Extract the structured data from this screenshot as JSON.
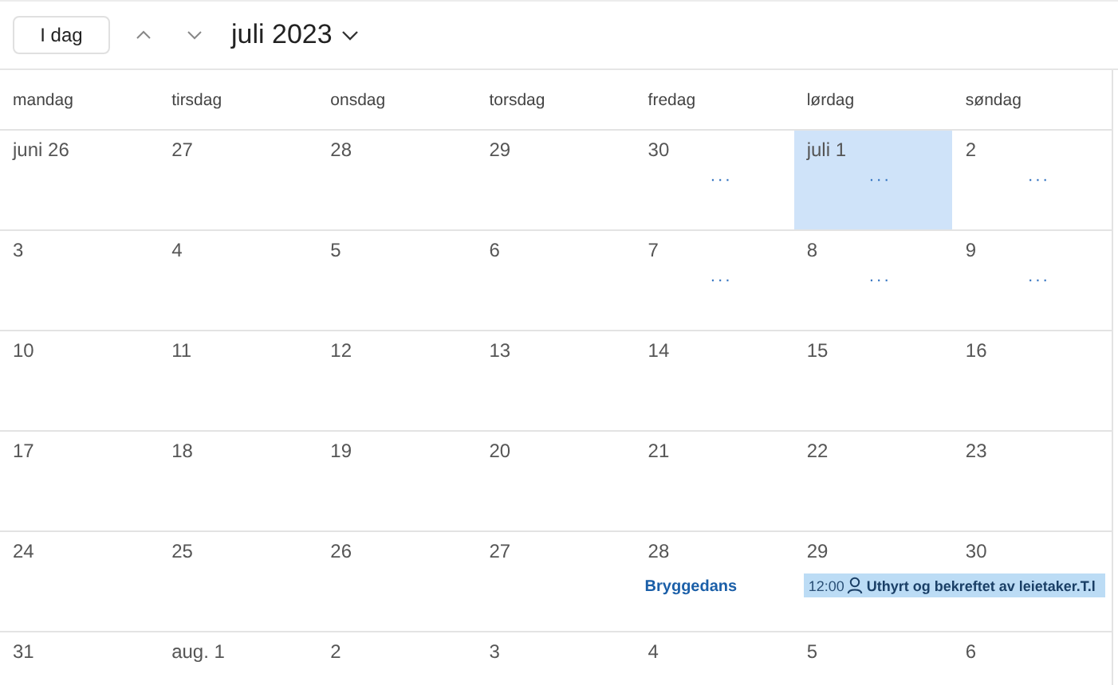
{
  "toolbar": {
    "today_button": "I dag",
    "month": "juli 2023"
  },
  "weekdays": [
    "mandag",
    "tirsdag",
    "onsdag",
    "torsdag",
    "fredag",
    "lørdag",
    "søndag"
  ],
  "weeks": [
    {
      "days": [
        {
          "label": "juni 26",
          "selected": false
        },
        {
          "label": "27",
          "selected": false
        },
        {
          "label": "28",
          "selected": false
        },
        {
          "label": "29",
          "selected": false
        },
        {
          "label": "30",
          "selected": false,
          "more": "···"
        },
        {
          "label": "juli 1",
          "selected": true,
          "more": "···"
        },
        {
          "label": "2",
          "selected": false,
          "more": "···"
        }
      ]
    },
    {
      "days": [
        {
          "label": "3",
          "selected": false
        },
        {
          "label": "4",
          "selected": false
        },
        {
          "label": "5",
          "selected": false
        },
        {
          "label": "6",
          "selected": false
        },
        {
          "label": "7",
          "selected": false,
          "more": "···"
        },
        {
          "label": "8",
          "selected": false,
          "more": "···"
        },
        {
          "label": "9",
          "selected": false,
          "more": "···"
        }
      ]
    },
    {
      "days": [
        {
          "label": "10",
          "selected": false
        },
        {
          "label": "11",
          "selected": false
        },
        {
          "label": "12",
          "selected": false
        },
        {
          "label": "13",
          "selected": false
        },
        {
          "label": "14",
          "selected": false
        },
        {
          "label": "15",
          "selected": false
        },
        {
          "label": "16",
          "selected": false
        }
      ]
    },
    {
      "days": [
        {
          "label": "17",
          "selected": false
        },
        {
          "label": "18",
          "selected": false
        },
        {
          "label": "19",
          "selected": false
        },
        {
          "label": "20",
          "selected": false
        },
        {
          "label": "21",
          "selected": false
        },
        {
          "label": "22",
          "selected": false
        },
        {
          "label": "23",
          "selected": false
        }
      ]
    },
    {
      "days": [
        {
          "label": "24",
          "selected": false
        },
        {
          "label": "25",
          "selected": false
        },
        {
          "label": "26",
          "selected": false
        },
        {
          "label": "27",
          "selected": false
        },
        {
          "label": "28",
          "selected": false,
          "event": {
            "kind": "plain",
            "title": "Bryggedans",
            "continues": false
          }
        },
        {
          "label": "29",
          "selected": false,
          "event": {
            "kind": "timed",
            "time": "12:00",
            "title": "Uthyrt og bekreftet av leietaker.T.l",
            "continues": true
          }
        },
        {
          "label": "30",
          "selected": false
        }
      ]
    },
    {
      "days": [
        {
          "label": "31",
          "selected": false
        },
        {
          "label": "aug. 1",
          "selected": false
        },
        {
          "label": "2",
          "selected": false
        },
        {
          "label": "3",
          "selected": false
        },
        {
          "label": "4",
          "selected": false
        },
        {
          "label": "5",
          "selected": false
        },
        {
          "label": "6",
          "selected": false
        }
      ]
    }
  ]
}
